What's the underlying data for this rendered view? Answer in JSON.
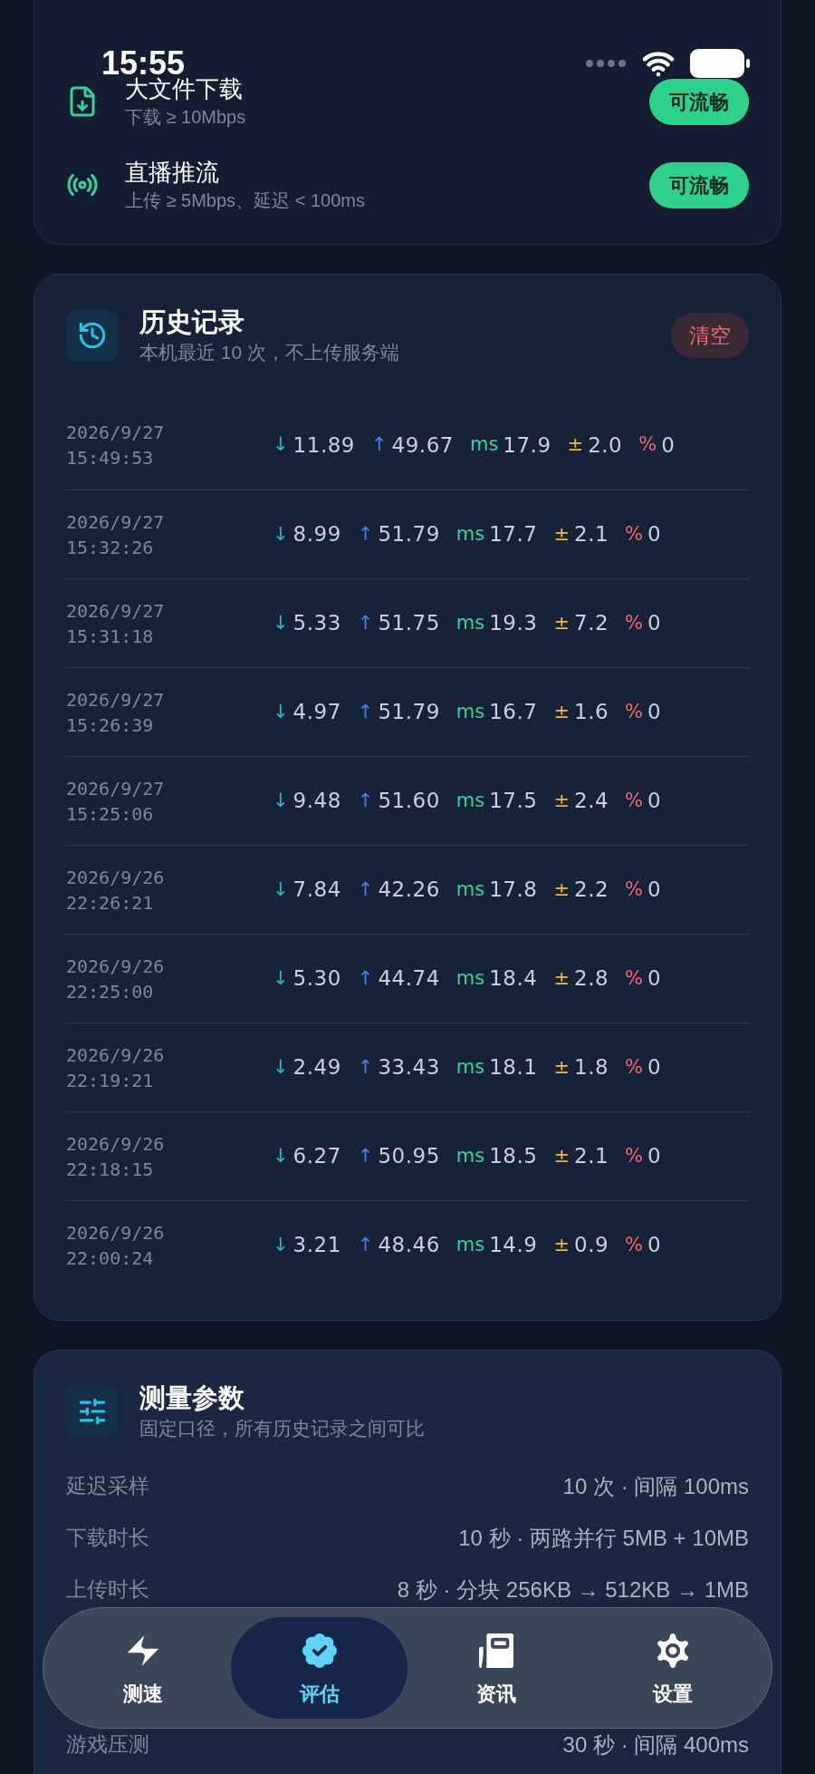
{
  "status_bar": {
    "time": "15:55"
  },
  "scenarios": [
    {
      "kind": "file",
      "title": "大文件下载",
      "requirement": "下载 ≥ 10Mbps",
      "verdict": "可流畅"
    },
    {
      "kind": "broadcast",
      "title": "直播推流",
      "requirement": "上传 ≥ 5Mbps、延迟 < 100ms",
      "verdict": "可流畅"
    }
  ],
  "history": {
    "title": "历史记录",
    "subtitle": "本机最近 10 次，不上传服务端",
    "clear_button": "清空",
    "rows": [
      {
        "date": "2026/9/27",
        "time": "15:49:53",
        "metrics": [
          {
            "kind": "down",
            "label": "↓",
            "value": "11.89"
          },
          {
            "kind": "up",
            "label": "↑",
            "value": "49.67"
          },
          {
            "kind": "ping",
            "label": "ms",
            "value": "17.9"
          },
          {
            "kind": "jitter",
            "label": "±",
            "value": "2.0"
          },
          {
            "kind": "loss",
            "label": "%",
            "value": "0"
          }
        ]
      },
      {
        "date": "2026/9/27",
        "time": "15:32:26",
        "metrics": [
          {
            "kind": "down",
            "label": "↓",
            "value": "8.99"
          },
          {
            "kind": "up",
            "label": "↑",
            "value": "51.79"
          },
          {
            "kind": "ping",
            "label": "ms",
            "value": "17.7"
          },
          {
            "kind": "jitter",
            "label": "±",
            "value": "2.1"
          },
          {
            "kind": "loss",
            "label": "%",
            "value": "0"
          }
        ]
      },
      {
        "date": "2026/9/27",
        "time": "15:31:18",
        "metrics": [
          {
            "kind": "down",
            "label": "↓",
            "value": "5.33"
          },
          {
            "kind": "up",
            "label": "↑",
            "value": "51.75"
          },
          {
            "kind": "ping",
            "label": "ms",
            "value": "19.3"
          },
          {
            "kind": "jitter",
            "label": "±",
            "value": "7.2"
          },
          {
            "kind": "loss",
            "label": "%",
            "value": "0"
          }
        ]
      },
      {
        "date": "2026/9/27",
        "time": "15:26:39",
        "metrics": [
          {
            "kind": "down",
            "label": "↓",
            "value": "4.97"
          },
          {
            "kind": "up",
            "label": "↑",
            "value": "51.79"
          },
          {
            "kind": "ping",
            "label": "ms",
            "value": "16.7"
          },
          {
            "kind": "jitter",
            "label": "±",
            "value": "1.6"
          },
          {
            "kind": "loss",
            "label": "%",
            "value": "0"
          }
        ]
      },
      {
        "date": "2026/9/27",
        "time": "15:25:06",
        "metrics": [
          {
            "kind": "down",
            "label": "↓",
            "value": "9.48"
          },
          {
            "kind": "up",
            "label": "↑",
            "value": "51.60"
          },
          {
            "kind": "ping",
            "label": "ms",
            "value": "17.5"
          },
          {
            "kind": "jitter",
            "label": "±",
            "value": "2.4"
          },
          {
            "kind": "loss",
            "label": "%",
            "value": "0"
          }
        ]
      },
      {
        "date": "2026/9/26",
        "time": "22:26:21",
        "metrics": [
          {
            "kind": "down",
            "label": "↓",
            "value": "7.84"
          },
          {
            "kind": "up",
            "label": "↑",
            "value": "42.26"
          },
          {
            "kind": "ping",
            "label": "ms",
            "value": "17.8"
          },
          {
            "kind": "jitter",
            "label": "±",
            "value": "2.2"
          },
          {
            "kind": "loss",
            "label": "%",
            "value": "0"
          }
        ]
      },
      {
        "date": "2026/9/26",
        "time": "22:25:00",
        "metrics": [
          {
            "kind": "down",
            "label": "↓",
            "value": "5.30"
          },
          {
            "kind": "up",
            "label": "↑",
            "value": "44.74"
          },
          {
            "kind": "ping",
            "label": "ms",
            "value": "18.4"
          },
          {
            "kind": "jitter",
            "label": "±",
            "value": "2.8"
          },
          {
            "kind": "loss",
            "label": "%",
            "value": "0"
          }
        ]
      },
      {
        "date": "2026/9/26",
        "time": "22:19:21",
        "metrics": [
          {
            "kind": "down",
            "label": "↓",
            "value": "2.49"
          },
          {
            "kind": "up",
            "label": "↑",
            "value": "33.43"
          },
          {
            "kind": "ping",
            "label": "ms",
            "value": "18.1"
          },
          {
            "kind": "jitter",
            "label": "±",
            "value": "1.8"
          },
          {
            "kind": "loss",
            "label": "%",
            "value": "0"
          }
        ]
      },
      {
        "date": "2026/9/26",
        "time": "22:18:15",
        "metrics": [
          {
            "kind": "down",
            "label": "↓",
            "value": "6.27"
          },
          {
            "kind": "up",
            "label": "↑",
            "value": "50.95"
          },
          {
            "kind": "ping",
            "label": "ms",
            "value": "18.5"
          },
          {
            "kind": "jitter",
            "label": "±",
            "value": "2.1"
          },
          {
            "kind": "loss",
            "label": "%",
            "value": "0"
          }
        ]
      },
      {
        "date": "2026/9/26",
        "time": "22:00:24",
        "metrics": [
          {
            "kind": "down",
            "label": "↓",
            "value": "3.21"
          },
          {
            "kind": "up",
            "label": "↑",
            "value": "48.46"
          },
          {
            "kind": "ping",
            "label": "ms",
            "value": "14.9"
          },
          {
            "kind": "jitter",
            "label": "±",
            "value": "0.9"
          },
          {
            "kind": "loss",
            "label": "%",
            "value": "0"
          }
        ]
      }
    ]
  },
  "parameters": {
    "title": "测量参数",
    "subtitle": "固定口径，所有历史记录之间可比",
    "rows": [
      {
        "label": "延迟采样",
        "value": "10 次 · 间隔 100ms"
      },
      {
        "label": "下载时长",
        "value": "10 秒 · 两路并行 5MB + 10MB"
      },
      {
        "label": "上传时长",
        "value": "8 秒 · 分块 256KB → 512KB → 1MB"
      },
      {
        "label": "游戏压测",
        "value": "30 秒 · 间隔 400ms"
      }
    ]
  },
  "tab_bar": [
    {
      "kind": "speed",
      "label": "测速",
      "selected": false
    },
    {
      "kind": "assess",
      "label": "评估",
      "selected": true
    },
    {
      "kind": "news",
      "label": "资讯",
      "selected": false
    },
    {
      "kind": "settings",
      "label": "设置",
      "selected": false
    }
  ]
}
